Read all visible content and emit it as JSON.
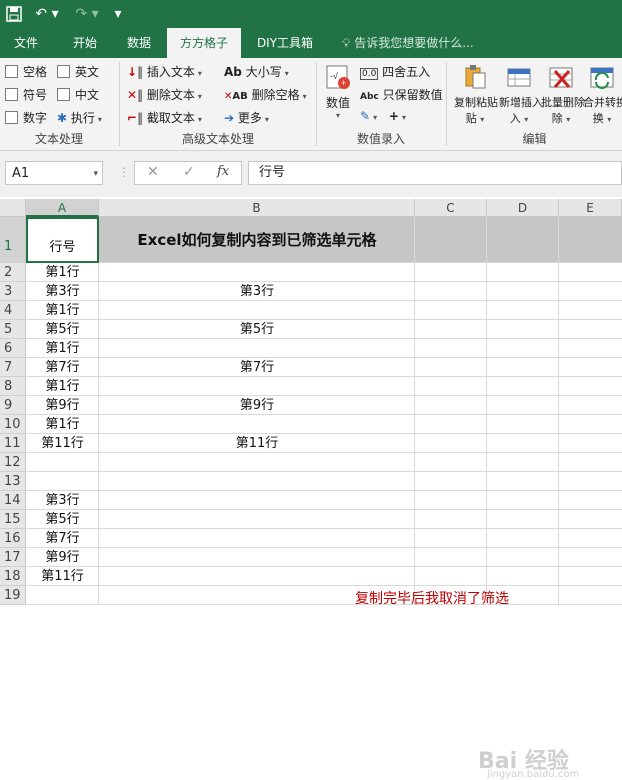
{
  "qat": {
    "save": "save-icon",
    "undo": "undo-icon",
    "redo": "redo-icon"
  },
  "tabs": [
    "文件",
    "开始",
    "数据",
    "方方格子",
    "DIY工具箱"
  ],
  "tell_me": "告诉我您想要做什么...",
  "ribbon": {
    "text_processing": {
      "checks": [
        "空格",
        "英文",
        "符号",
        "中文",
        "数字"
      ],
      "execute": "执行",
      "label": "文本处理"
    },
    "advanced": {
      "items": [
        "插入文本",
        "删除文本",
        "截取文本"
      ],
      "case": "大小写",
      "del_space": "删除空格",
      "more": "更多",
      "label": "高级文本处理"
    },
    "numeric": {
      "value": "数值",
      "round": "四舍五入",
      "keep": "只保留数值",
      "label": "数值录入"
    },
    "edit": {
      "copy_paste": "复制粘贴",
      "add_insert": "新增插入",
      "batch_delete": "批量删除",
      "merge": "合并转换",
      "label": "编辑"
    }
  },
  "formula_bar": {
    "name_box": "A1",
    "cancel": "✕",
    "enter": "✓",
    "fx": "fx",
    "content": "行号"
  },
  "columns": [
    "A",
    "B",
    "C",
    "D",
    "E"
  ],
  "title_cell": "Excel如何复制内容到已筛选单元格",
  "rows": [
    {
      "n": "1",
      "a": "行号",
      "b": ""
    },
    {
      "n": "2",
      "a": "第1行",
      "b": ""
    },
    {
      "n": "3",
      "a": "第3行",
      "b": "第3行"
    },
    {
      "n": "4",
      "a": "第1行",
      "b": ""
    },
    {
      "n": "5",
      "a": "第5行",
      "b": "第5行"
    },
    {
      "n": "6",
      "a": "第1行",
      "b": ""
    },
    {
      "n": "7",
      "a": "第7行",
      "b": "第7行"
    },
    {
      "n": "8",
      "a": "第1行",
      "b": ""
    },
    {
      "n": "9",
      "a": "第9行",
      "b": "第9行"
    },
    {
      "n": "10",
      "a": "第1行",
      "b": ""
    },
    {
      "n": "11",
      "a": "第11行",
      "b": "第11行"
    },
    {
      "n": "12",
      "a": "",
      "b": ""
    },
    {
      "n": "13",
      "a": "",
      "b": ""
    },
    {
      "n": "14",
      "a": "第3行",
      "b": ""
    },
    {
      "n": "15",
      "a": "第5行",
      "b": ""
    },
    {
      "n": "16",
      "a": "第7行",
      "b": ""
    },
    {
      "n": "17",
      "a": "第9行",
      "b": ""
    },
    {
      "n": "18",
      "a": "第11行",
      "b": ""
    },
    {
      "n": "19",
      "a": "",
      "b": ""
    }
  ],
  "note": "复制完毕后我取消了筛选",
  "watermark": {
    "main": "Bai 经验",
    "sub": "jingyan.baidu.com"
  }
}
